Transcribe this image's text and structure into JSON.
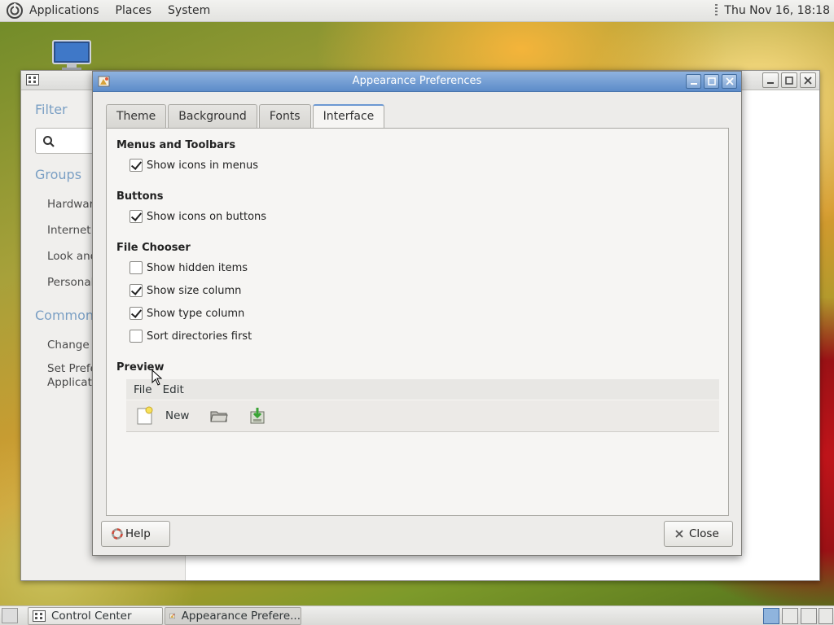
{
  "top_panel": {
    "menus": [
      "Applications",
      "Places",
      "System"
    ],
    "clock": "Thu Nov 16, 18:18"
  },
  "control_center": {
    "filter_heading": "Filter",
    "search_icon": "search-icon",
    "groups_heading": "Groups",
    "groups": [
      "Hardware",
      "Internet a",
      "Look and",
      "Personal"
    ],
    "common_heading": "Common T",
    "common_tasks": [
      "Change T",
      "Set Prefe",
      "Applicatio"
    ]
  },
  "dialog": {
    "title": "Appearance Preferences",
    "tabs": [
      "Theme",
      "Background",
      "Fonts",
      "Interface"
    ],
    "active_tab": "Interface",
    "sections": {
      "menus_toolbars": {
        "title": "Menus and Toolbars",
        "options": [
          {
            "label": "Show icons in menus",
            "checked": true
          }
        ]
      },
      "buttons": {
        "title": "Buttons",
        "options": [
          {
            "label": "Show icons on buttons",
            "checked": true
          }
        ]
      },
      "file_chooser": {
        "title": "File Chooser",
        "options": [
          {
            "label": "Show hidden items",
            "checked": false
          },
          {
            "label": "Show size column",
            "checked": true
          },
          {
            "label": "Show type column",
            "checked": true
          },
          {
            "label": "Sort directories first",
            "checked": false
          }
        ]
      },
      "preview": {
        "title": "Preview",
        "menu": [
          "File",
          "Edit"
        ],
        "toolbar_new": "New",
        "toolbar_icons": [
          "open-folder-icon",
          "save-icon"
        ]
      }
    },
    "help_button": "Help",
    "close_button": "Close"
  },
  "taskbar": {
    "tasks": [
      "Control Center",
      "Appearance Prefere..."
    ],
    "active_task": 1
  },
  "colors": {
    "titlebar_active": "#6d97cf",
    "tab_highlight": "#6c98d2",
    "section_heading": "#7a9fc4"
  }
}
